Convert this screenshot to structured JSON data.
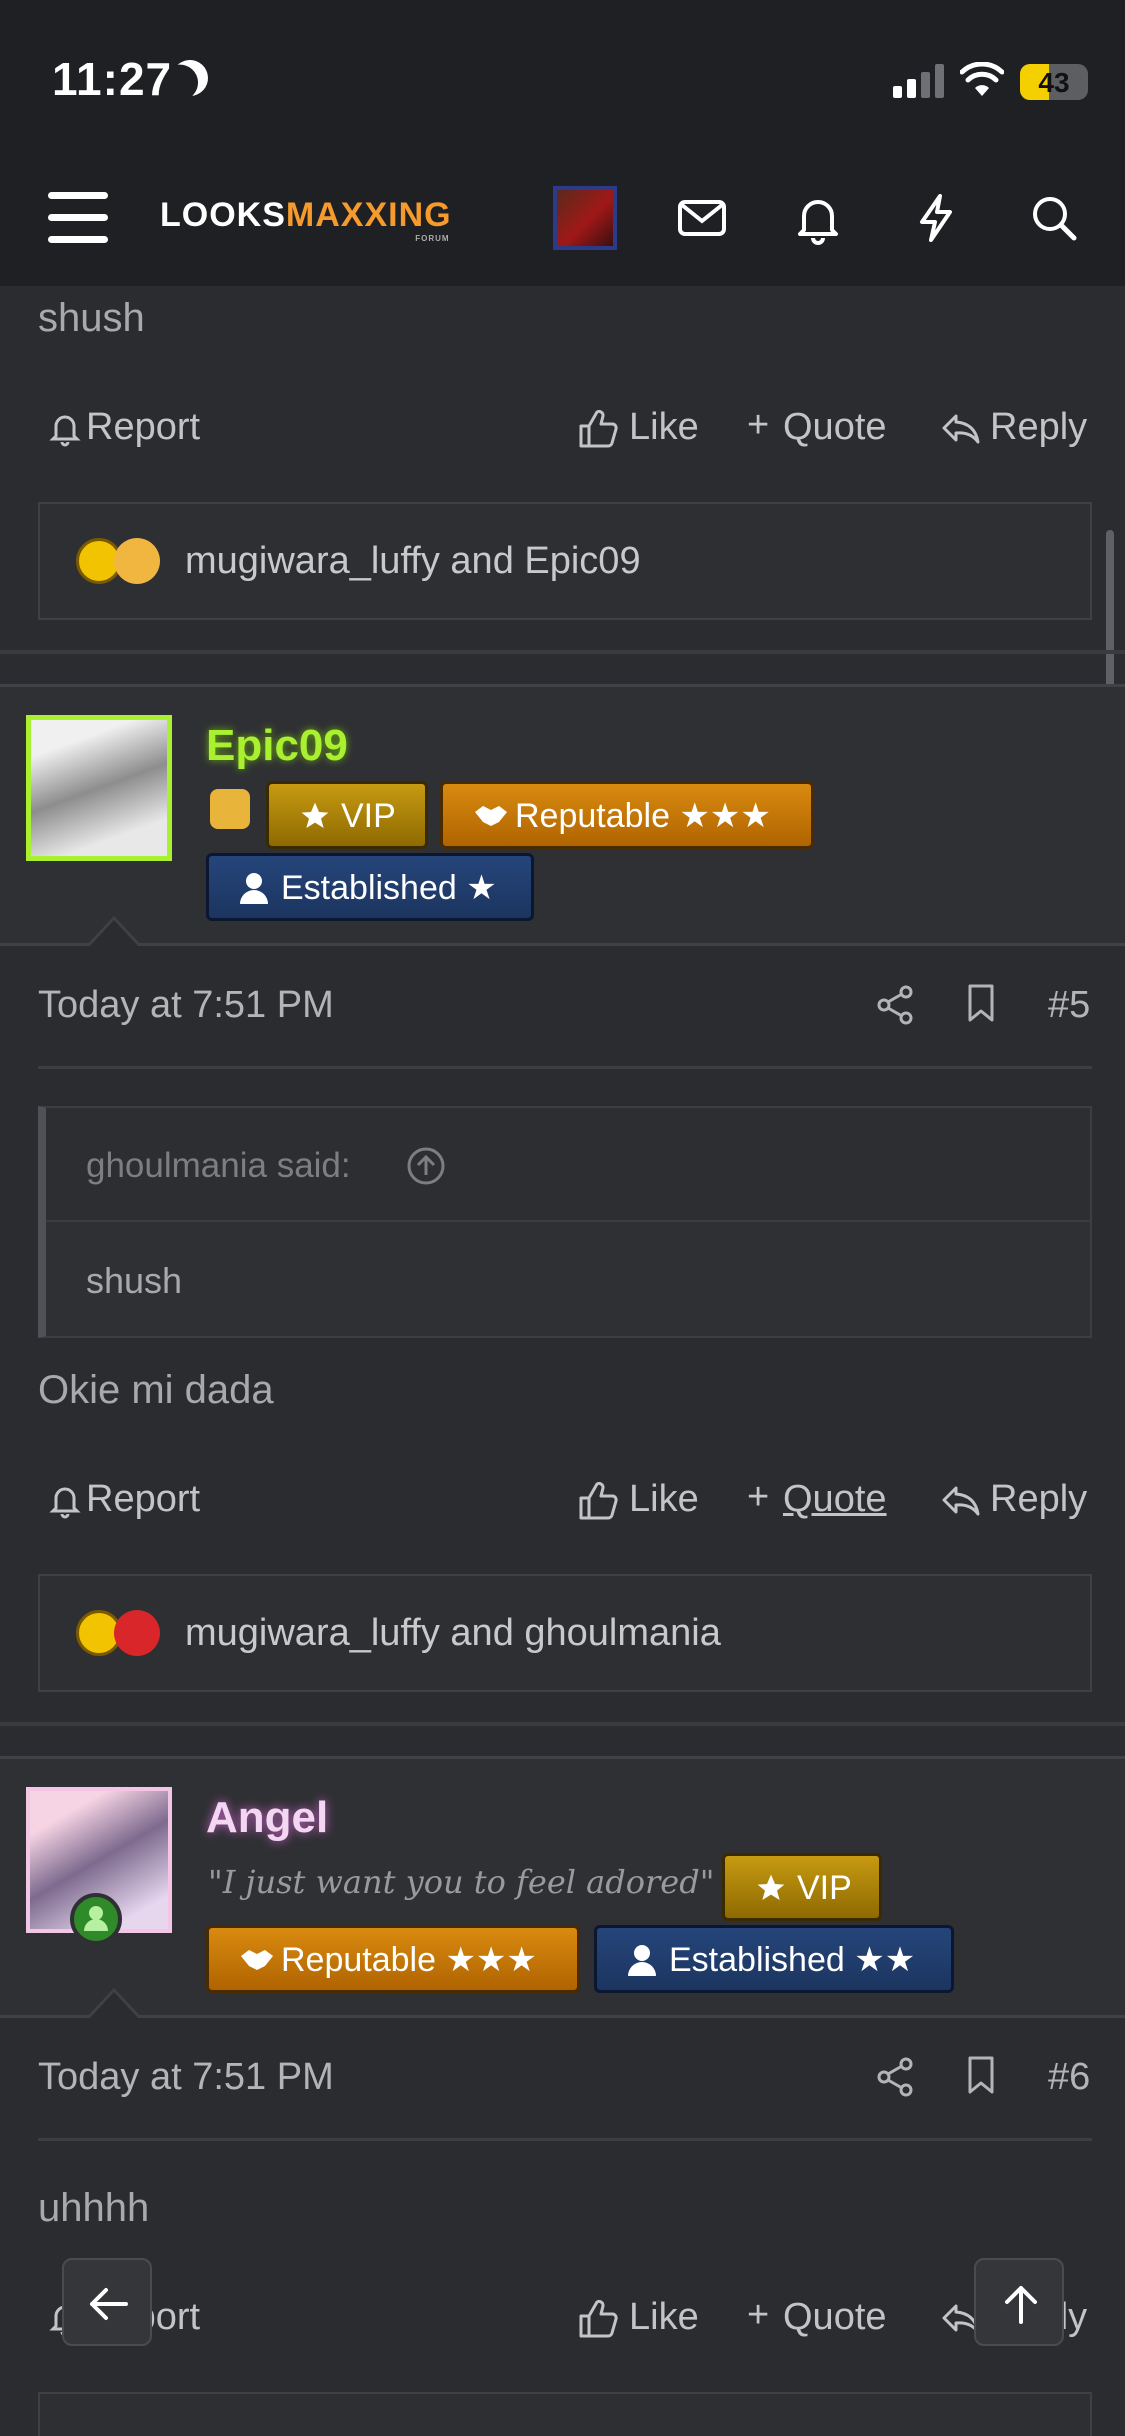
{
  "status_bar": {
    "time": "11:27",
    "battery_percent": "43"
  },
  "header": {
    "logo_main": "LOOKS",
    "logo_accent": "MAXXING",
    "logo_sub": "FORUM",
    "icons": [
      "menu-icon",
      "avatar",
      "mail-icon",
      "bell-icon",
      "bolt-icon",
      "search-icon"
    ]
  },
  "post4_tail": {
    "text": "shush",
    "reactions": "mugiwara_luffy and Epic09"
  },
  "actions": {
    "report": "Report",
    "like": "Like",
    "quote": "Quote",
    "reply": "Reply"
  },
  "post5": {
    "username": "Epic09",
    "badges": {
      "vip": "VIP",
      "reputable": "Reputable ★★★",
      "established": "Established ★"
    },
    "date": "Today at 7:51 PM",
    "number": "#5",
    "quote_author": "ghoulmania said:",
    "quote_text": "shush",
    "body": "Okie mi dada",
    "reactions": "mugiwara_luffy and ghoulmania"
  },
  "post6": {
    "username": "Angel",
    "status": "\"I just want you to feel adored\" ❦",
    "badges": {
      "vip": "VIP",
      "reputable": "Reputable ★★★",
      "established": "Established ★★"
    },
    "date": "Today at 7:51 PM",
    "number": "#6",
    "body": "uhhhh"
  },
  "colors": {
    "accent_orange": "#f59a2c",
    "epic_name": "#a8f030",
    "angel_name": "#f2d6f2"
  }
}
